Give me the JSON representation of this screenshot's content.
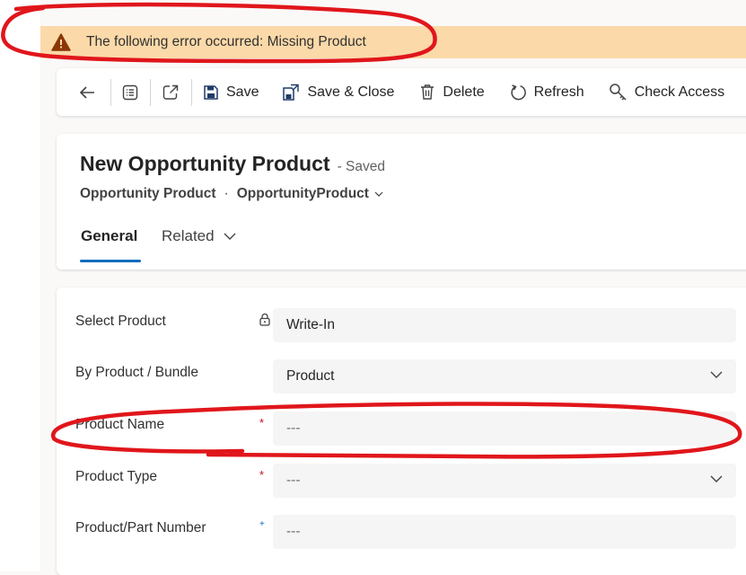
{
  "banner": {
    "message": "The following error occurred: Missing Product"
  },
  "toolbar": {
    "save": "Save",
    "save_close": "Save & Close",
    "delete": "Delete",
    "refresh": "Refresh",
    "check_access": "Check Access"
  },
  "record": {
    "title": "New Opportunity Product",
    "status": "- Saved",
    "entity": "Opportunity Product",
    "separator": "·",
    "form_name": "OpportunityProduct"
  },
  "tabs": {
    "general": "General",
    "related": "Related"
  },
  "fields": [
    {
      "label": "Select Product",
      "value": "Write-In",
      "marker": "lock"
    },
    {
      "label": "By Product / Bundle",
      "value": "Product",
      "marker": ""
    },
    {
      "label": "Product Name",
      "value": "---",
      "marker": "*"
    },
    {
      "label": "Product Type",
      "value": "---",
      "marker": "*"
    },
    {
      "label": "Product/Part Number",
      "value": "---",
      "marker": "+"
    }
  ],
  "colors": {
    "banner_bg": "#fbd9a9",
    "annotation_red": "#e0161b",
    "tab_accent": "#0f6cbd",
    "required": "#c50f1f"
  }
}
